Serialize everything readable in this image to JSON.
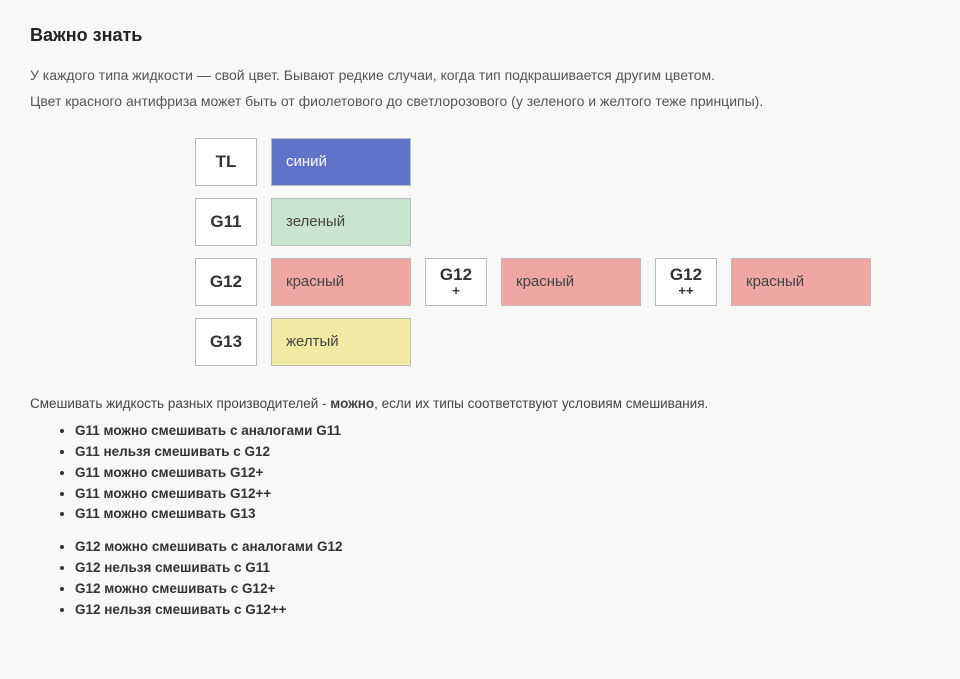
{
  "heading": "Важно знать",
  "intro1": "У каждого типа жидкости — свой цвет. Бывают редкие случаи, когда тип подкрашивается другим цветом.",
  "intro2": "Цвет красного антифриза может быть от фиолетового до светлорозового (у зеленого и желтого теже принципы).",
  "codes": {
    "tl": "TL",
    "g11": "G11",
    "g12": "G12",
    "g12p": "G12",
    "g12p_sub": "+",
    "g12pp": "G12",
    "g12pp_sub": "++",
    "g13": "G13"
  },
  "colors_label": {
    "blue": "синий",
    "green": "зеленый",
    "red": "красный",
    "yellow": "желтый"
  },
  "swatches": {
    "blue": "#6073c9",
    "green": "#c9e5cf",
    "red": "#efa7a3",
    "yellow": "#f0eaa3"
  },
  "mix_prefix": "Смешивать жидкость разных производителей - ",
  "mix_bold": "можно",
  "mix_suffix": ", если их типы соответствуют условиям смешивания.",
  "rules_g11": [
    "G11 можно смешивать с аналогами G11",
    "G11 нельзя смешивать с G12",
    "G11 можно смешивать G12+",
    "G11 можно смешивать G12++",
    "G11 можно смешивать G13"
  ],
  "rules_g12": [
    "G12 можно смешивать с аналогами G12",
    "G12 нельзя смешивать с G11",
    "G12 можно смешивать с G12+",
    "G12 нельзя смешивать с G12++"
  ]
}
